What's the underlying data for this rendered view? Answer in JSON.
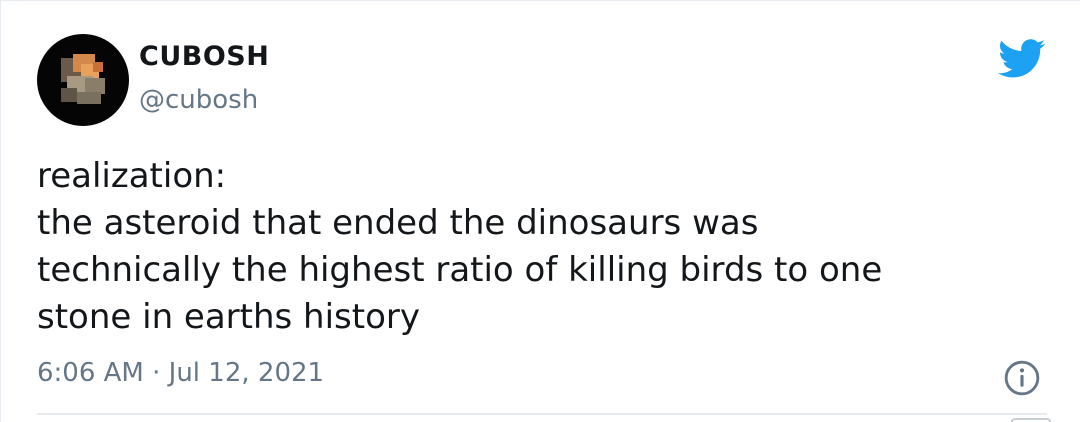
{
  "tweet": {
    "author": {
      "display_name": "CUBOSH",
      "handle": "@cubosh",
      "avatar_icon": "pixelated-avatar"
    },
    "text_lines": [
      "realization:",
      "the asteroid that ended the dinosaurs was",
      "technically the highest ratio of killing birds to one",
      "stone in earths history"
    ],
    "timestamp": "6:06 AM · Jul 12, 2021",
    "brand_icon": "twitter-bird-icon",
    "info_icon": "info-icon"
  },
  "colors": {
    "twitter_blue": "#1da1f2",
    "text_primary": "#14171a",
    "text_secondary": "#657786",
    "divider": "#e6ecf0"
  }
}
